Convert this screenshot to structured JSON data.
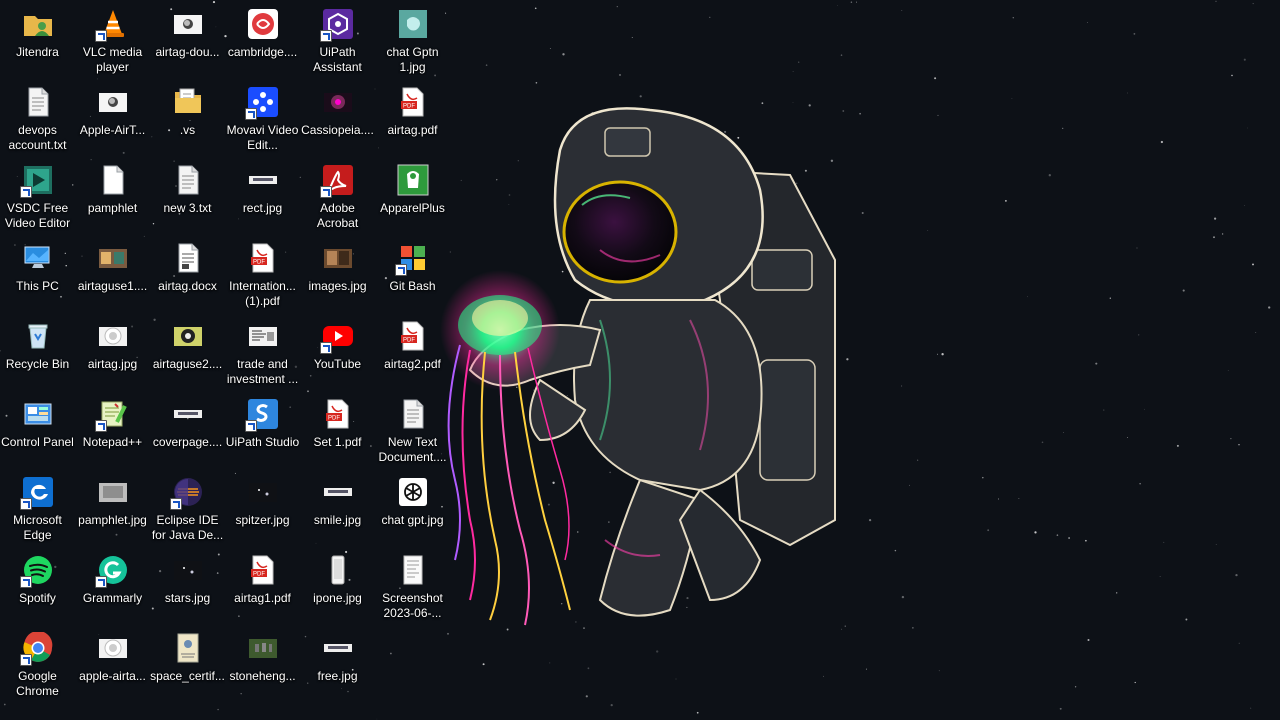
{
  "desktop": {
    "columns": [
      [
        {
          "name": "user-folder",
          "label": "Jitendra",
          "icon": "user-folder-icon",
          "kind": "userfolder",
          "shortcut": false
        },
        {
          "name": "devops-account-txt",
          "label": "devops account.txt",
          "icon": "text-file-icon",
          "kind": "txt",
          "shortcut": false
        },
        {
          "name": "vsdc-video-editor",
          "label": "VSDC Free Video Editor",
          "icon": "vsdc-icon",
          "kind": "vsdc",
          "shortcut": true
        },
        {
          "name": "this-pc",
          "label": "This PC",
          "icon": "computer-icon",
          "kind": "pc",
          "shortcut": false
        },
        {
          "name": "recycle-bin",
          "label": "Recycle Bin",
          "icon": "recycle-bin-icon",
          "kind": "bin",
          "shortcut": false
        },
        {
          "name": "control-panel",
          "label": "Control Panel",
          "icon": "control-panel-icon",
          "kind": "cpanel",
          "shortcut": false
        },
        {
          "name": "microsoft-edge",
          "label": "Microsoft Edge",
          "icon": "edge-icon",
          "kind": "edge",
          "shortcut": true
        },
        {
          "name": "spotify",
          "label": "Spotify",
          "icon": "spotify-icon",
          "kind": "spotify",
          "shortcut": true
        },
        {
          "name": "google-chrome",
          "label": "Google Chrome",
          "icon": "chrome-icon",
          "kind": "chrome",
          "shortcut": true
        }
      ],
      [
        {
          "name": "vlc-media-player",
          "label": "VLC media player",
          "icon": "vlc-icon",
          "kind": "vlc",
          "shortcut": true
        },
        {
          "name": "apple-airtag-image",
          "label": "Apple-AirT...",
          "icon": "image-thumbnail-icon",
          "kind": "imgwhite",
          "shortcut": false
        },
        {
          "name": "pamphlet",
          "label": "pamphlet",
          "icon": "text-file-icon",
          "kind": "blank",
          "shortcut": false
        },
        {
          "name": "airtaguse1-image",
          "label": "airtaguse1....",
          "icon": "image-thumbnail-icon",
          "kind": "imgcolor",
          "shortcut": false
        },
        {
          "name": "airtag-jpg",
          "label": "airtag.jpg",
          "icon": "image-thumbnail-icon",
          "kind": "imgairtag",
          "shortcut": false
        },
        {
          "name": "notepad-plus-plus",
          "label": "Notepad++",
          "icon": "notepad-plus-plus-icon",
          "kind": "npp",
          "shortcut": true
        },
        {
          "name": "pamphlet-jpg",
          "label": "pamphlet.jpg",
          "icon": "image-thumbnail-icon",
          "kind": "imggray",
          "shortcut": false
        },
        {
          "name": "grammarly",
          "label": "Grammarly",
          "icon": "grammarly-icon",
          "kind": "grammarly",
          "shortcut": true
        },
        {
          "name": "apple-airtag-image-2",
          "label": "apple-airta...",
          "icon": "image-thumbnail-icon",
          "kind": "imgairtag",
          "shortcut": false
        }
      ],
      [
        {
          "name": "airtag-download",
          "label": "airtag-dou...",
          "icon": "image-thumbnail-icon",
          "kind": "imgwhite",
          "shortcut": false
        },
        {
          "name": "vs-folder",
          "label": ".vs",
          "icon": "folder-icon",
          "kind": "folder",
          "shortcut": false
        },
        {
          "name": "new-3-txt",
          "label": "new 3.txt",
          "icon": "text-file-icon",
          "kind": "txt",
          "shortcut": false
        },
        {
          "name": "airtag-docx",
          "label": "airtag.docx",
          "icon": "document-icon",
          "kind": "doc",
          "shortcut": false
        },
        {
          "name": "airtaguse2-image",
          "label": "airtaguse2....",
          "icon": "image-thumbnail-icon",
          "kind": "imgeye",
          "shortcut": false
        },
        {
          "name": "coverpage-image",
          "label": "coverpage....",
          "icon": "image-thumbnail-icon",
          "kind": "imgstrip",
          "shortcut": false
        },
        {
          "name": "eclipse-ide",
          "label": "Eclipse IDE for Java De...",
          "icon": "eclipse-icon",
          "kind": "eclipse",
          "shortcut": true
        },
        {
          "name": "stars-jpg",
          "label": "stars.jpg",
          "icon": "image-thumbnail-icon",
          "kind": "imgdark",
          "shortcut": false
        },
        {
          "name": "space-certificate-image",
          "label": "space_certif...",
          "icon": "image-thumbnail-icon",
          "kind": "imgcert",
          "shortcut": false
        }
      ],
      [
        {
          "name": "cambridge-app",
          "label": "cambridge....",
          "icon": "cambridge-icon",
          "kind": "cambridge",
          "shortcut": false
        },
        {
          "name": "movavi-video-editor",
          "label": "Movavi Video Edit...",
          "icon": "movavi-icon",
          "kind": "movavi",
          "shortcut": true
        },
        {
          "name": "rect-jpg",
          "label": "rect.jpg",
          "icon": "image-thumbnail-icon",
          "kind": "imgstrip",
          "shortcut": false
        },
        {
          "name": "international-pdf",
          "label": "Internation... (1).pdf",
          "icon": "pdf-icon",
          "kind": "pdf",
          "shortcut": false
        },
        {
          "name": "trade-and-investment",
          "label": "trade and investment ...",
          "icon": "document-icon",
          "kind": "doc2",
          "shortcut": false
        },
        {
          "name": "uipath-studio",
          "label": "UiPath Studio",
          "icon": "uipath-studio-icon",
          "kind": "uistudio",
          "shortcut": true
        },
        {
          "name": "spitzer-jpg",
          "label": "spitzer.jpg",
          "icon": "image-thumbnail-icon",
          "kind": "imgdark",
          "shortcut": false
        },
        {
          "name": "airtag1-pdf",
          "label": "airtag1.pdf",
          "icon": "pdf-icon",
          "kind": "pdf",
          "shortcut": false
        },
        {
          "name": "stonehenge-image",
          "label": "stoneheng...",
          "icon": "image-thumbnail-icon",
          "kind": "imggreen",
          "shortcut": false
        }
      ],
      [
        {
          "name": "uipath-assistant",
          "label": "UiPath Assistant",
          "icon": "uipath-assistant-icon",
          "kind": "uiassist",
          "shortcut": true
        },
        {
          "name": "cassiopeia-image",
          "label": "Cassiopeia....",
          "icon": "image-thumbnail-icon",
          "kind": "imgnebula",
          "shortcut": false
        },
        {
          "name": "adobe-acrobat",
          "label": "Adobe Acrobat",
          "icon": "acrobat-icon",
          "kind": "acrobat",
          "shortcut": true
        },
        {
          "name": "images-jpg",
          "label": "images.jpg",
          "icon": "image-thumbnail-icon",
          "kind": "imgbrown",
          "shortcut": false
        },
        {
          "name": "youtube",
          "label": "YouTube",
          "icon": "youtube-icon",
          "kind": "youtube",
          "shortcut": true
        },
        {
          "name": "set-1-pdf",
          "label": "Set 1.pdf",
          "icon": "pdf-icon",
          "kind": "pdf",
          "shortcut": false
        },
        {
          "name": "smile-jpg",
          "label": "smile.jpg",
          "icon": "image-thumbnail-icon",
          "kind": "imgstrip",
          "shortcut": false
        },
        {
          "name": "ipone-jpg",
          "label": "ipone.jpg",
          "icon": "image-thumbnail-icon",
          "kind": "imgphone",
          "shortcut": false
        },
        {
          "name": "free-jpg",
          "label": "free.jpg",
          "icon": "image-thumbnail-icon",
          "kind": "imgstrip",
          "shortcut": false
        }
      ],
      [
        {
          "name": "chat-gptn-1-jpg",
          "label": "chat Gptn 1.jpg",
          "icon": "image-thumbnail-icon",
          "kind": "imgteal",
          "shortcut": false
        },
        {
          "name": "airtag-pdf",
          "label": "airtag.pdf",
          "icon": "pdf-icon",
          "kind": "pdf",
          "shortcut": false
        },
        {
          "name": "apparelplus",
          "label": "ApparelPlus",
          "icon": "apparelplus-icon",
          "kind": "apparel",
          "shortcut": false
        },
        {
          "name": "git-bash",
          "label": "Git Bash",
          "icon": "git-bash-icon",
          "kind": "gitbash",
          "shortcut": true
        },
        {
          "name": "airtag2-pdf",
          "label": "airtag2.pdf",
          "icon": "pdf-icon",
          "kind": "pdf",
          "shortcut": false
        },
        {
          "name": "new-text-document",
          "label": "New Text Document....",
          "icon": "text-file-icon",
          "kind": "txt",
          "shortcut": false
        },
        {
          "name": "chat-gpt-jpg",
          "label": "chat gpt.jpg",
          "icon": "chatgpt-icon",
          "kind": "chatgpt",
          "shortcut": false
        },
        {
          "name": "screenshot-2023",
          "label": "Screenshot 2023-06-...",
          "icon": "image-thumbnail-icon",
          "kind": "imgshot",
          "shortcut": false
        }
      ]
    ]
  },
  "wallpaper": {
    "subject": "astronaut-holding-glowing-jellyfish",
    "sky_color": "#0d1117",
    "suit_color": "#2a2d33",
    "glow_colors": [
      "#00ff99",
      "#ff2aa0",
      "#ffd23f",
      "#6a5cff"
    ]
  }
}
